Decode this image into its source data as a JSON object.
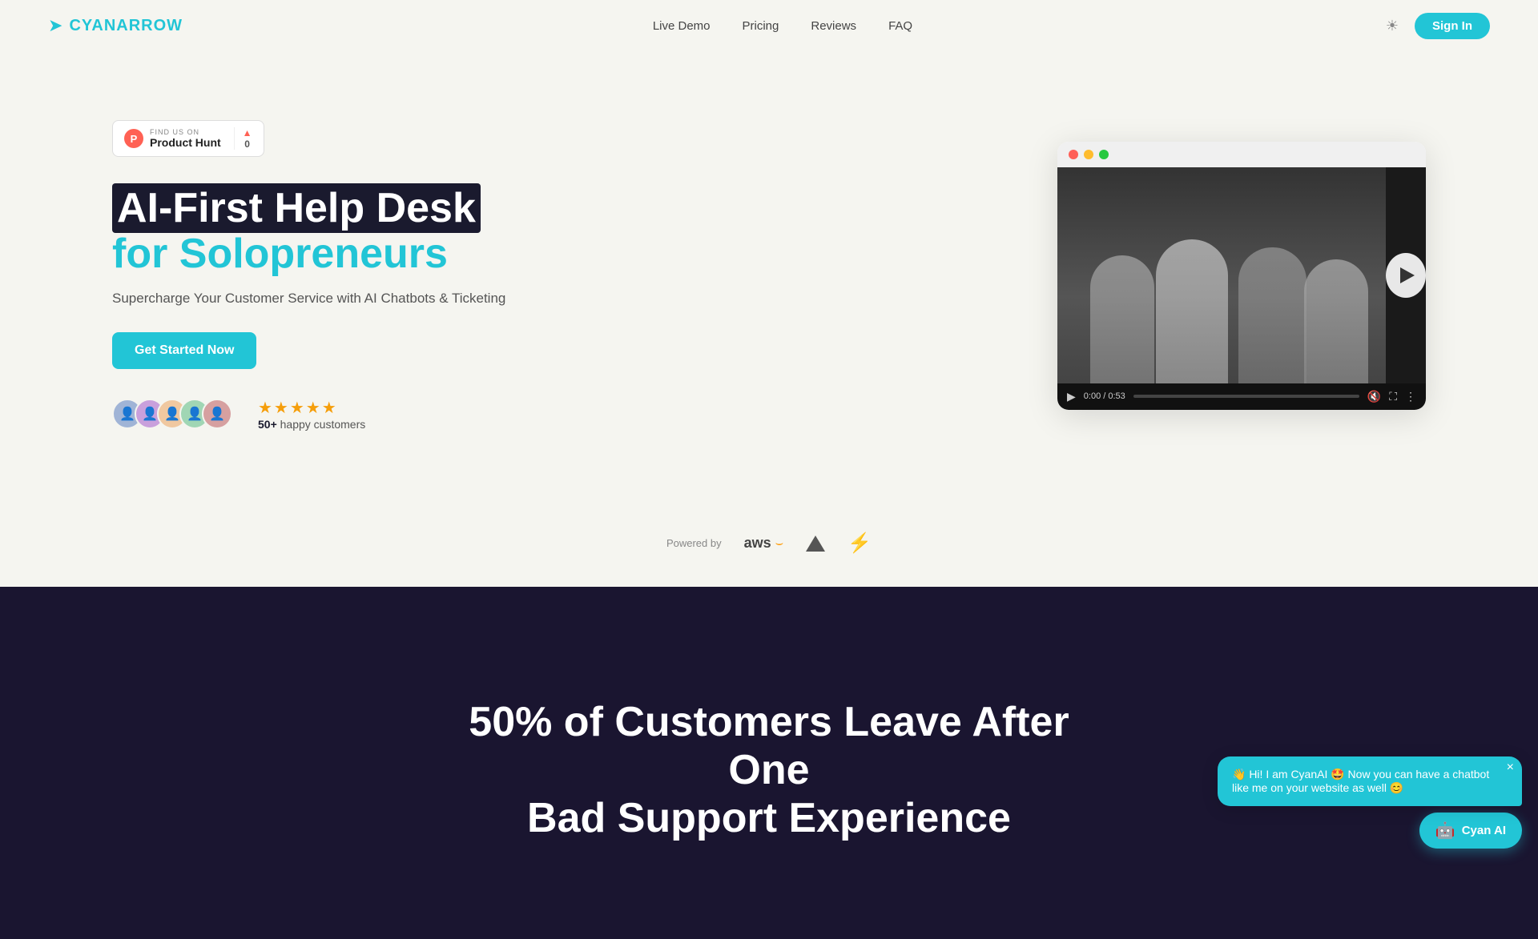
{
  "nav": {
    "logo_text_main": "CYAN",
    "logo_text_accent": "ARROW",
    "links": [
      {
        "id": "live-demo",
        "label": "Live Demo"
      },
      {
        "id": "pricing",
        "label": "Pricing"
      },
      {
        "id": "reviews",
        "label": "Reviews"
      },
      {
        "id": "faq",
        "label": "FAQ"
      }
    ],
    "signin_label": "Sign In"
  },
  "product_hunt": {
    "find_text": "FIND US ON",
    "name": "Product Hunt",
    "vote_count": "0"
  },
  "hero": {
    "headline_part1": "AI-First Help Desk",
    "headline_part2": "for Solopreneurs",
    "subtitle": "Supercharge Your Customer Service with AI Chatbots & Ticketing",
    "cta_label": "Get Started Now",
    "social_proof": {
      "customer_count": "50+",
      "customer_label": "happy customers",
      "star_count": 5
    }
  },
  "video": {
    "time_current": "0:00",
    "time_total": "0:53"
  },
  "powered_by": {
    "label": "Powered by"
  },
  "dark_section": {
    "headline_part1": "50% of Customers Leave After One",
    "headline_part2": "Bad Support Experience"
  },
  "chat": {
    "bubble_text": "👋 Hi! I am CyanAI 🤩 Now you can have a chatbot like me on your website as well 😊",
    "button_label": "Cyan AI",
    "close_icon": "×"
  }
}
